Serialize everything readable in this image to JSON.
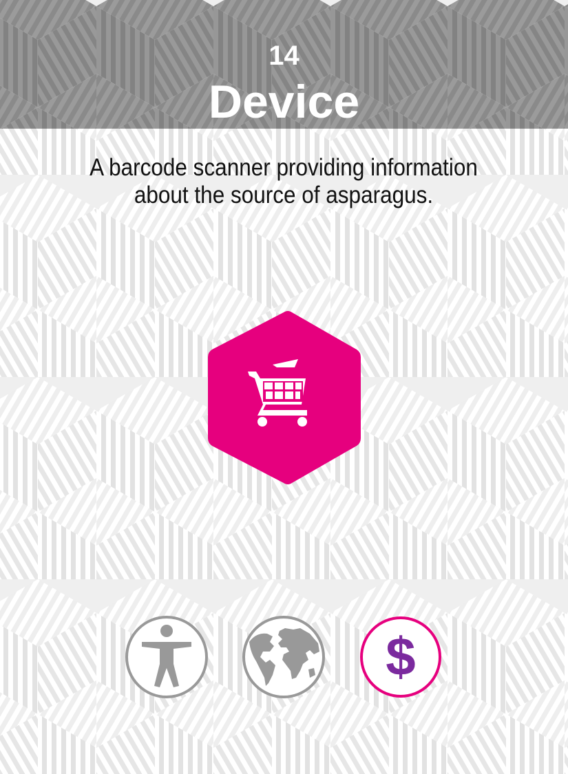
{
  "card": {
    "number": "14",
    "title": "Device",
    "description": "A barcode scanner providing information about the source of asparagus."
  },
  "main_icon": {
    "name": "shopping-cart-icon",
    "color": "#e6007e"
  },
  "badges": [
    {
      "name": "accessibility-person-icon",
      "color": "#999999",
      "active": false
    },
    {
      "name": "globe-icon",
      "color": "#999999",
      "active": false
    },
    {
      "name": "dollar-icon",
      "color": "#7b2a9e",
      "ring": "#e6007e",
      "active": true
    }
  ],
  "colors": {
    "header_bg": "#8f8f8f",
    "background": "#efefef",
    "accent": "#e6007e"
  }
}
